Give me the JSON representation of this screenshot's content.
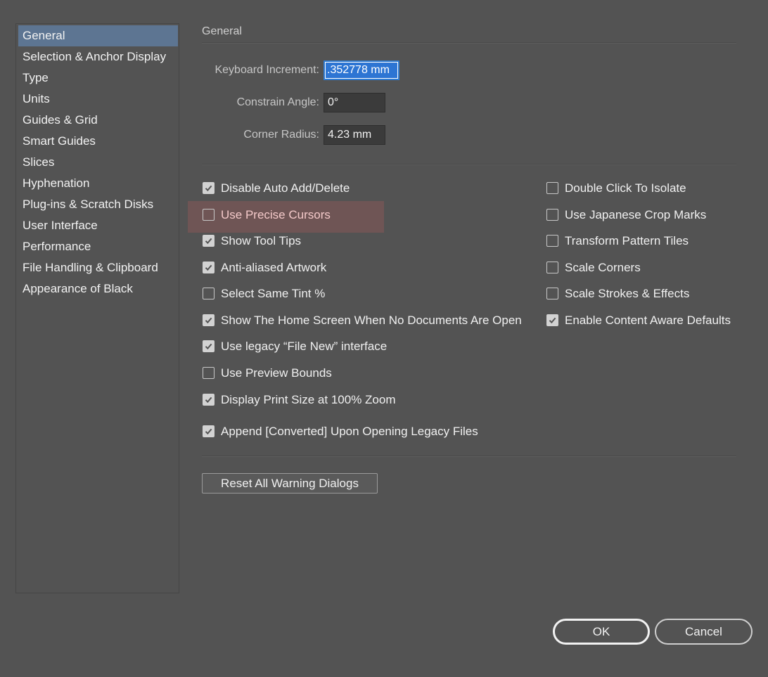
{
  "sidebar": {
    "items": [
      {
        "label": "General"
      },
      {
        "label": "Selection & Anchor Display"
      },
      {
        "label": "Type"
      },
      {
        "label": "Units"
      },
      {
        "label": "Guides & Grid"
      },
      {
        "label": "Smart Guides"
      },
      {
        "label": "Slices"
      },
      {
        "label": "Hyphenation"
      },
      {
        "label": "Plug-ins & Scratch Disks"
      },
      {
        "label": "User Interface"
      },
      {
        "label": "Performance"
      },
      {
        "label": "File Handling & Clipboard"
      },
      {
        "label": "Appearance of Black"
      }
    ],
    "selected_label": "General"
  },
  "panel": {
    "title": "General",
    "fields": {
      "keyboard_increment": {
        "label": "Keyboard Increment:",
        "value": ".352778 mm"
      },
      "constrain_angle": {
        "label": "Constrain Angle:",
        "value": "0°"
      },
      "corner_radius": {
        "label": "Corner Radius:",
        "value": "4.23 mm"
      }
    },
    "options_left": [
      {
        "label": "Disable Auto Add/Delete",
        "checked": true
      },
      {
        "label": "Use Precise Cursors",
        "checked": false
      },
      {
        "label": "Show Tool Tips",
        "checked": true
      },
      {
        "label": "Anti-aliased Artwork",
        "checked": true
      },
      {
        "label": "Select Same Tint %",
        "checked": false
      },
      {
        "label": "Show The Home Screen When No Documents Are Open",
        "checked": true
      },
      {
        "label": "Use legacy “File New” interface",
        "checked": true
      },
      {
        "label": "Use Preview Bounds",
        "checked": false
      },
      {
        "label": "Display Print Size at 100% Zoom",
        "checked": true
      },
      {
        "label": "Append [Converted] Upon Opening Legacy Files",
        "checked": true
      }
    ],
    "options_right": [
      {
        "label": "Double Click To Isolate",
        "checked": false
      },
      {
        "label": "Use Japanese Crop Marks",
        "checked": false
      },
      {
        "label": "Transform Pattern Tiles",
        "checked": false
      },
      {
        "label": "Scale Corners",
        "checked": false
      },
      {
        "label": "Scale Strokes & Effects",
        "checked": false
      },
      {
        "label": "Enable Content Aware Defaults",
        "checked": true
      }
    ],
    "reset_button_label": "Reset All Warning Dialogs"
  },
  "footer": {
    "ok_label": "OK",
    "cancel_label": "Cancel"
  },
  "colors": {
    "background": "#535353",
    "selection": "#5d7592",
    "focus": "#2d75d3",
    "highlight": "#aa5a5a"
  }
}
